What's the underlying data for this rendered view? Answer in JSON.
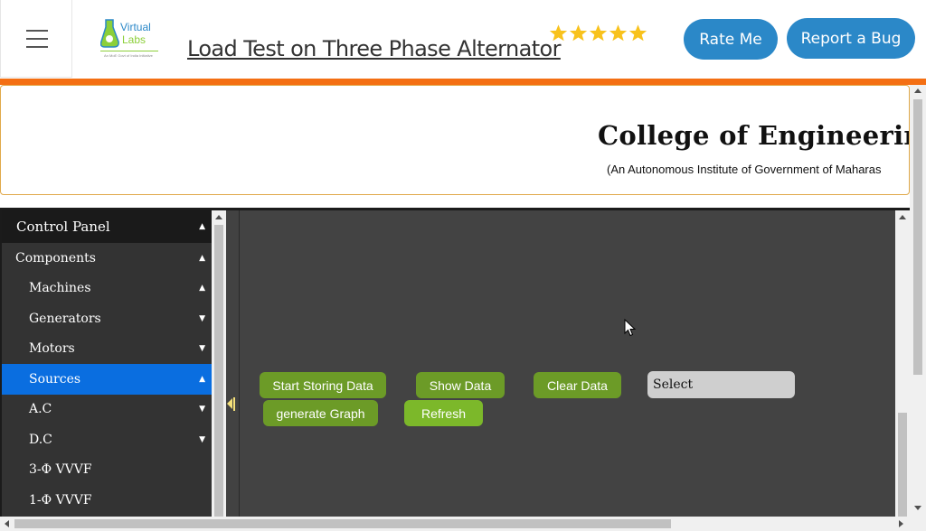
{
  "header": {
    "title": "Load Test on Three Phase Alternator",
    "menu_icon": "hamburger-menu-icon",
    "logo": {
      "name": "Virtual Labs",
      "line1": "Virtual",
      "line2": "Labs",
      "tagline": "An MoE Govt of India Initiative"
    },
    "rating_stars": 5,
    "rate_label": "Rate Me",
    "bug_label": "Report a Bug",
    "colors": {
      "accent": "#2b88c8",
      "orange_bar": "#f46f13",
      "star": "#f8c21c"
    }
  },
  "banner": {
    "college_name": "College of Engineering,",
    "college_subtitle": "(An Autonomous Institute of Government of Maharas"
  },
  "sidebar": {
    "header": "Control Panel",
    "items": [
      {
        "label": "Components",
        "caret": "▲"
      },
      {
        "label": "Machines",
        "caret": "▲"
      },
      {
        "label": "Generators",
        "caret": "▼"
      },
      {
        "label": "Motors",
        "caret": "▼"
      },
      {
        "label": "Sources",
        "caret": "▲"
      },
      {
        "label": "A.C",
        "caret": "▼"
      },
      {
        "label": "D.C",
        "caret": "▼"
      },
      {
        "label": "3-Φ VVVF",
        "caret": ""
      },
      {
        "label": "1-Φ VVVF",
        "caret": ""
      }
    ],
    "header_caret": "▲",
    "active_color": "#0a6ee0"
  },
  "workspace": {
    "buttons": {
      "start_storing": "Start Storing Data",
      "show_data": "Show Data",
      "clear_data": "Clear Data",
      "generate_graph": "generate Graph",
      "refresh": "Refresh"
    },
    "select_value": "Select",
    "button_color": "#6c9b27"
  }
}
